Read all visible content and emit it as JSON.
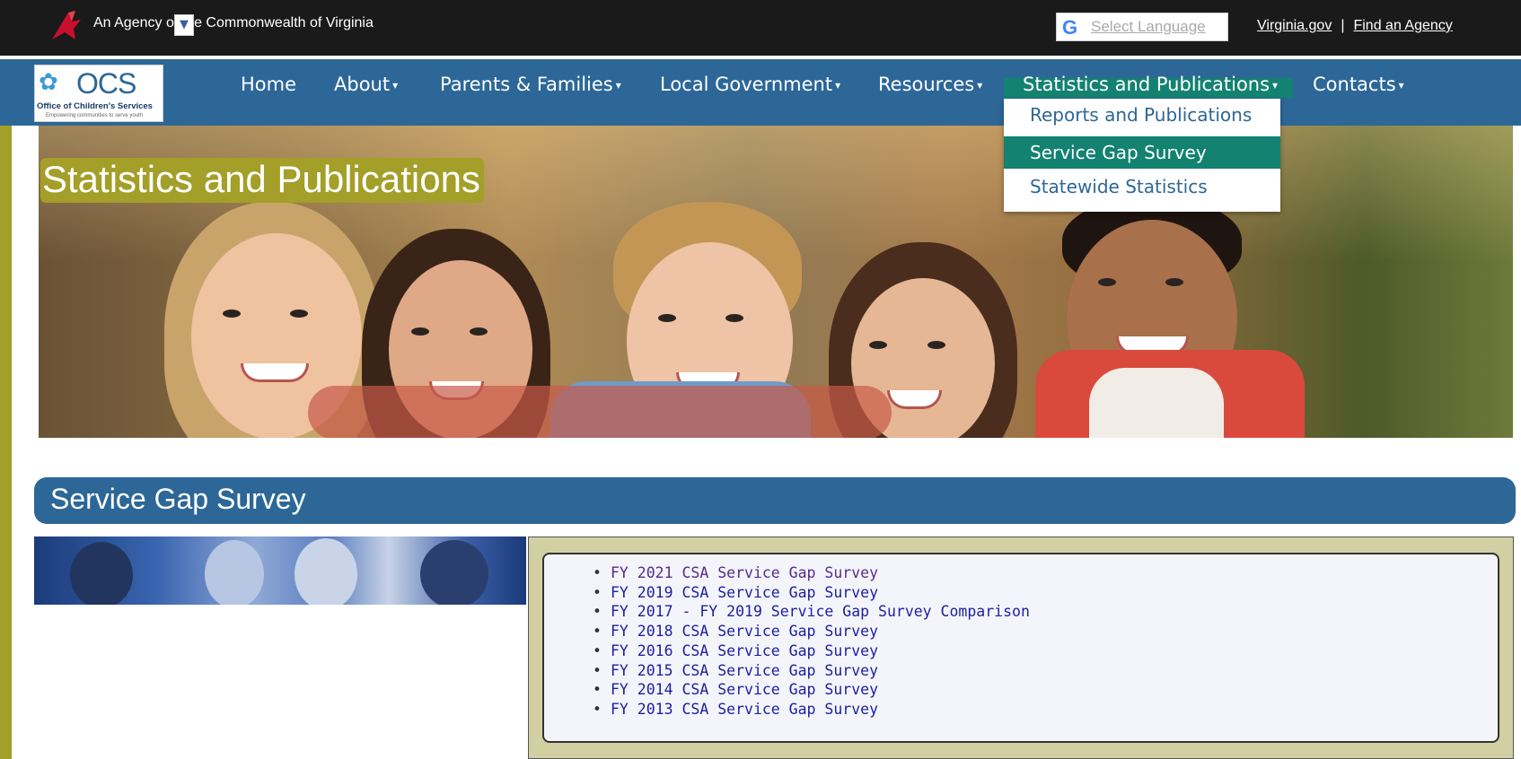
{
  "agency_bar": {
    "text": "An Agency of the Commonwealth of Virginia",
    "translate_label": "Select Language",
    "translate_dropdown_arrow": "▼",
    "links": [
      "Virginia.gov",
      "Find an Agency"
    ],
    "separator": "|"
  },
  "logo": {
    "abbreviation": "OCS",
    "name": "Office of Children's Services",
    "tagline": "Empowering communities to serve youth"
  },
  "nav": {
    "items": [
      {
        "label": "Home",
        "has_caret": false
      },
      {
        "label": "About",
        "has_caret": true
      },
      {
        "label": "Parents & Families",
        "has_caret": true
      },
      {
        "label": "Local Government",
        "has_caret": true
      },
      {
        "label": "Resources",
        "has_caret": true
      },
      {
        "label": "Statistics and Publications",
        "has_caret": true,
        "active": true
      },
      {
        "label": "Contacts",
        "has_caret": true
      }
    ],
    "caret_glyph": "▾"
  },
  "dropdown": {
    "items": [
      {
        "label": "Reports and Publications"
      },
      {
        "label": "Service Gap Survey",
        "active": true
      },
      {
        "label": "Statewide Statistics"
      }
    ]
  },
  "hero": {
    "title": "Statistics and Publications"
  },
  "section": {
    "title": "Service Gap Survey"
  },
  "surveys": [
    "FY 2021 CSA Service Gap Survey",
    "FY 2019 CSA Service Gap Survey",
    "FY 2017 - FY 2019 Service Gap Survey Comparison",
    "FY 2018 CSA Service Gap Survey",
    "FY 2016 CSA Service Gap Survey",
    "FY 2015 CSA Service Gap Survey",
    "FY 2014 CSA Service Gap Survey",
    "FY 2013 CSA Service Gap Survey"
  ],
  "colors": {
    "nav_blue": "#2c6797",
    "active_teal": "#138270",
    "olive": "#a39f28",
    "link_blue": "#1e1ea0"
  }
}
